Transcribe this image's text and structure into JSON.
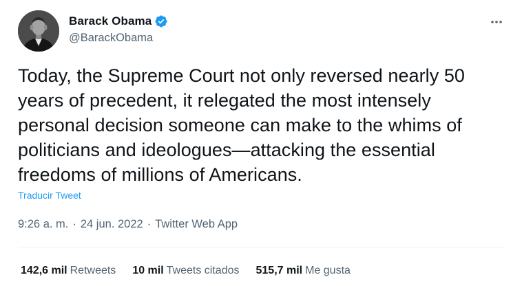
{
  "author": {
    "name": "Barack Obama",
    "handle": "@BarackObama",
    "verified_icon": "verified-badge-icon"
  },
  "menu": {
    "icon": "more-horizontal-icon"
  },
  "tweet": {
    "lines": [
      "Today, the Supreme Court not only reversed nearly 50",
      "years of precedent, it relegated the most intensely",
      "personal decision someone can make to the whims of",
      "politicians and ideologues—attacking the essential",
      "freedoms of millions of Americans."
    ],
    "translate_label": "Traducir Tweet"
  },
  "meta": {
    "time": "9:26 a. m.",
    "separator": "·",
    "date": "24 jun. 2022",
    "source": "Twitter Web App"
  },
  "stats": {
    "retweets": {
      "count": "142,6 mil",
      "label": "Retweets"
    },
    "quotes": {
      "count": "10 mil",
      "label": "Tweets citados"
    },
    "likes": {
      "count": "515,7 mil",
      "label": "Me gusta"
    }
  },
  "colors": {
    "accent": "#1d9bf0",
    "text": "#0f1419",
    "muted": "#536471",
    "divider": "#eff3f4"
  }
}
